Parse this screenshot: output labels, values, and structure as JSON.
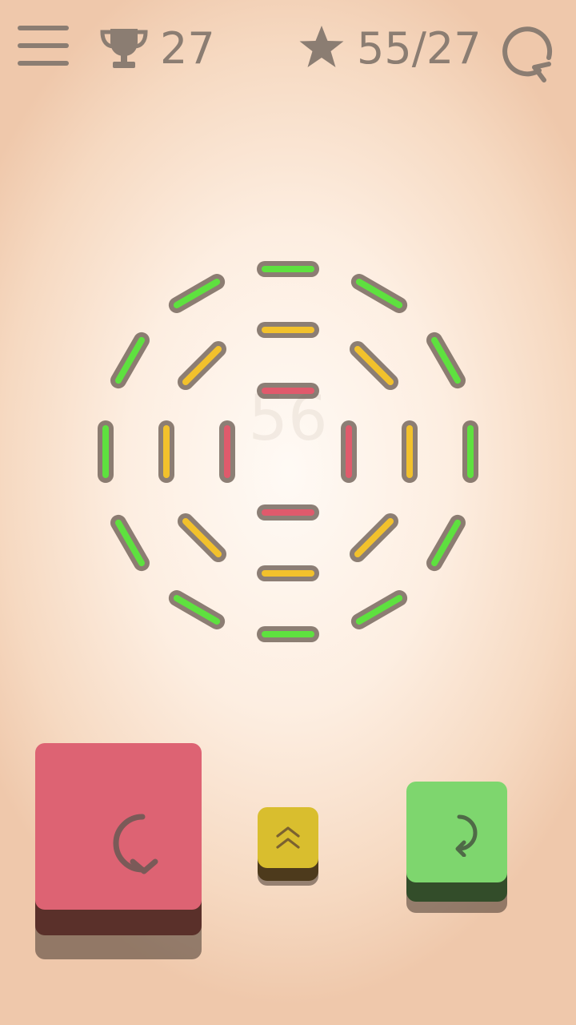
{
  "header": {
    "best_score": "27",
    "stars": "55/27"
  },
  "level": {
    "number": "56"
  },
  "colors": {
    "ring_outer": "#5ee13f",
    "ring_middle": "#f2c12c",
    "ring_inner": "#e05a6c",
    "button_red": "#dd6373",
    "button_yellow": "#d9be2e",
    "button_green": "#7ed66e",
    "icon": "#8b7d72"
  },
  "icons": {
    "menu": "hamburger-icon",
    "trophy": "trophy-icon",
    "star": "star-icon",
    "restart": "restart-icon",
    "rotate_left": "rotate-counterclockwise-icon",
    "rotate_right": "rotate-clockwise-icon",
    "move_up": "double-chevron-up-icon"
  }
}
